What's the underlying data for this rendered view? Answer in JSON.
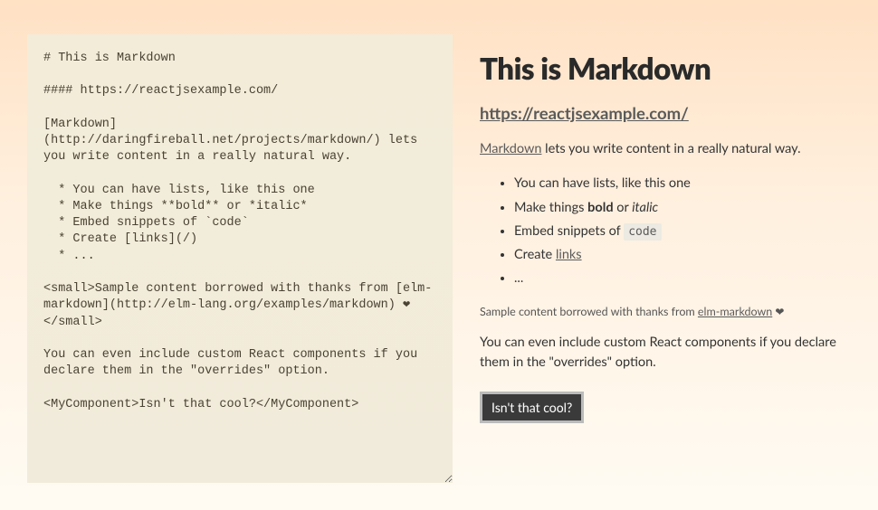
{
  "editor": {
    "raw": "# This is Markdown\n\n#### https://reactjsexample.com/\n\n[Markdown](http://daringfireball.net/projects/markdown/) lets you write content in a really natural way.\n\n  * You can have lists, like this one\n  * Make things **bold** or *italic*\n  * Embed snippets of `code`\n  * Create [links](/)\n  * ...\n\n<small>Sample content borrowed with thanks from [elm-markdown](http://elm-lang.org/examples/markdown) ❤</small>\n\nYou can even include custom React components if you declare them in the \"overrides\" option.\n\n<MyComponent>Isn't that cool?</MyComponent>"
  },
  "preview": {
    "h1": "This is Markdown",
    "h4_link_text": "https://reactjsexample.com/",
    "intro_link": "Markdown",
    "intro_rest": " lets you write content in a really natural way.",
    "list": {
      "i0": "You can have lists, like this one",
      "i1_pre": "Make things ",
      "i1_bold": "bold",
      "i1_mid": " or ",
      "i1_italic": "italic",
      "i2_pre": "Embed snippets of ",
      "i2_code": "code",
      "i3_pre": "Create ",
      "i3_link": "links",
      "i4": "..."
    },
    "small_pre": "Sample content borrowed with thanks from ",
    "small_link": "elm-markdown",
    "small_heart": " ❤",
    "para2": "You can even include custom React components if you declare them in the \"overrides\" option.",
    "component_text": "Isn't that cool?"
  }
}
